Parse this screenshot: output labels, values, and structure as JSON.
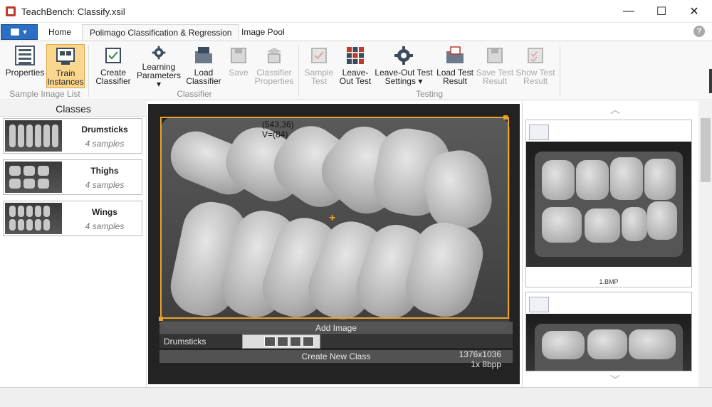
{
  "window": {
    "title": "TeachBench: Classify.xsil",
    "minimize": "—",
    "maximize": "☐",
    "close": "✕"
  },
  "tabs": [
    {
      "label": "Home"
    },
    {
      "label": "Polimago Classification & Regression"
    },
    {
      "label": "Image Pool"
    }
  ],
  "help": "?",
  "ribbon": {
    "properties": "Properties",
    "train_line1": "Train",
    "train_line2": "Instances",
    "group_sample": "Sample Image List",
    "create_line1": "Create",
    "create_line2": "Classifier",
    "learning_line1": "Learning",
    "learning_line2": "Parameters",
    "load_line1": "Load",
    "load_line2": "Classifier",
    "save": "Save",
    "cprops_line1": "Classifier",
    "cprops_line2": "Properties",
    "group_classifier": "Classifier",
    "sample_line1": "Sample",
    "sample_line2": "Test",
    "leaveout_line1": "Leave-",
    "leaveout_line2": "Out Test",
    "lots_line1": "Leave-Out Test",
    "lots_line2": "Settings",
    "loadtest_line1": "Load Test",
    "loadtest_line2": "Result",
    "savetest_line1": "Save Test",
    "savetest_line2": "Result",
    "showtest_line1": "Show Test",
    "showtest_line2": "Result",
    "group_testing": "Testing"
  },
  "classes_panel": {
    "title": "Classes",
    "items": [
      {
        "name": "Drumsticks",
        "count": "4 samples"
      },
      {
        "name": "Thighs",
        "count": "4 samples"
      },
      {
        "name": "Wings",
        "count": "4 samples"
      }
    ]
  },
  "viewer": {
    "coord_line1": "(543,36)",
    "coord_line2": "V=(84)",
    "add_image": "Add Image",
    "class_label": "Drumsticks",
    "create_class": "Create New Class",
    "size_line1": "1376x1036",
    "size_line2": "1x 8bpp"
  },
  "pool": {
    "items": [
      {
        "filename": "1.BMP"
      },
      {
        "filename": ""
      }
    ]
  },
  "colors": {
    "accent": "#2b6fc4",
    "roi": "#e9a22a",
    "active_button": "#fbd68f"
  }
}
